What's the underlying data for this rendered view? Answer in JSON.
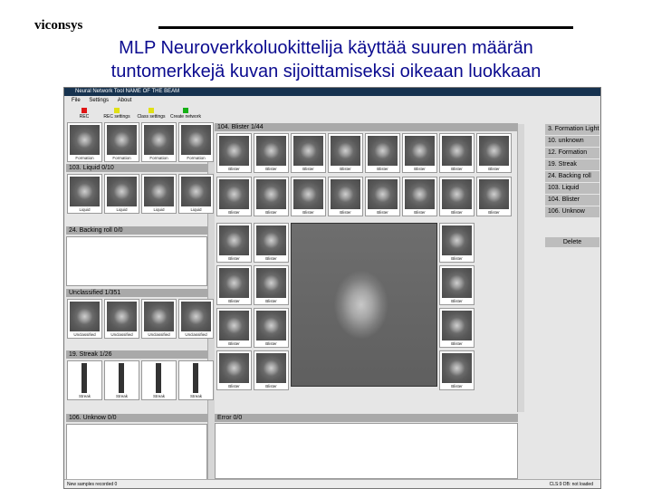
{
  "slide": {
    "brand": "viconsys",
    "title_line1": "MLP Neuroverkkoluokittelija käyttää suuren määrän",
    "title_line2": "tuntomerkkejä kuvan sijoittamiseksi oikeaan luokkaan"
  },
  "window": {
    "title": "Neural Network Tool  NAME OF THE BEAM",
    "menu": [
      "File",
      "Settings",
      "About"
    ],
    "toolbar": [
      {
        "label": "REC",
        "color": "#e01515"
      },
      {
        "label": "REC settings",
        "color": "#e0e015"
      },
      {
        "label": "Class settings",
        "color": "#e0e015"
      },
      {
        "label": "Create network",
        "color": "#15b015"
      }
    ]
  },
  "left_groups": [
    {
      "header": "",
      "caption": "Formation",
      "kind": "dark"
    },
    {
      "header": "103. Liquid  0/10",
      "caption": "Liquid",
      "kind": "dark"
    },
    {
      "header": "24. Backing roll  0/0",
      "caption": "",
      "kind": "empty"
    },
    {
      "header": "Unclassified  1/351",
      "caption": "Unclassified",
      "kind": "dark"
    },
    {
      "header": "19. Streak  1/26",
      "caption": "Streak",
      "kind": "streak"
    },
    {
      "header": "106. Unknow  0/0",
      "caption": "",
      "kind": "empty"
    }
  ],
  "center": {
    "header": "104. Blister  1/44",
    "thumb_caption": "Blister",
    "error_header": "Error  0/0"
  },
  "class_list": [
    "3. Formation Light",
    "10. unknown",
    "12. Formation",
    "19. Streak",
    "24. Backing roll",
    "103. Liquid",
    "104. Blister",
    "106. Unknow"
  ],
  "delete_label": "Delete",
  "status": {
    "left": "New samples recorded 0",
    "right": "CLS:9  DB: not loaded"
  }
}
